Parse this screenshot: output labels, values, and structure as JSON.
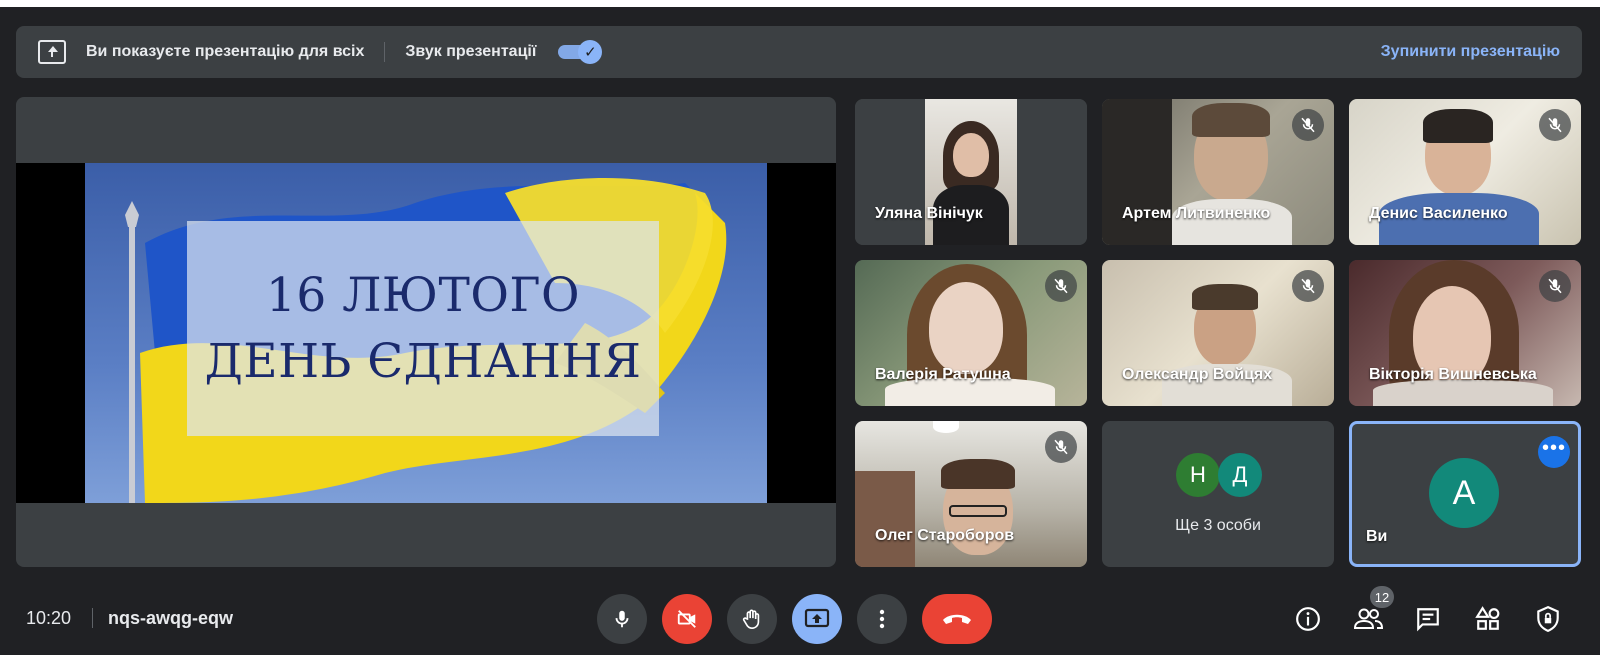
{
  "banner": {
    "message": "Ви показуєте презентацію для всіх",
    "sound_label": "Звук презентації",
    "sound_enabled": true,
    "stop_label": "Зупинити презентацію"
  },
  "presentation": {
    "line1": "16 ЛЮТОГО",
    "line2": "ДЕНЬ ЄДНАННЯ"
  },
  "participants": [
    {
      "name": "Уляна Вінічук",
      "muted": false
    },
    {
      "name": "Артем Литвиненко",
      "muted": true
    },
    {
      "name": "Денис Василенко",
      "muted": true
    },
    {
      "name": "Валерія Ратушна",
      "muted": true
    },
    {
      "name": "Олександр Войцях",
      "muted": true
    },
    {
      "name": "Вікторія Вишневська",
      "muted": true
    },
    {
      "name": "Олег Староборов",
      "muted": true
    }
  ],
  "others": {
    "initials": [
      "Н",
      "Д"
    ],
    "label": "Ще 3 особи"
  },
  "self": {
    "initial": "A",
    "label": "Ви"
  },
  "bottom": {
    "time": "10:20",
    "meeting_code": "nqs-awqg-eqw",
    "participants_count": "12"
  },
  "colors": {
    "background": "#202124",
    "surface": "#3c4043",
    "accent": "#8ab4f8",
    "danger": "#ea4335",
    "self_avatar": "#12897a",
    "initial_n": "#2e7d32",
    "initial_d": "#12897a"
  }
}
